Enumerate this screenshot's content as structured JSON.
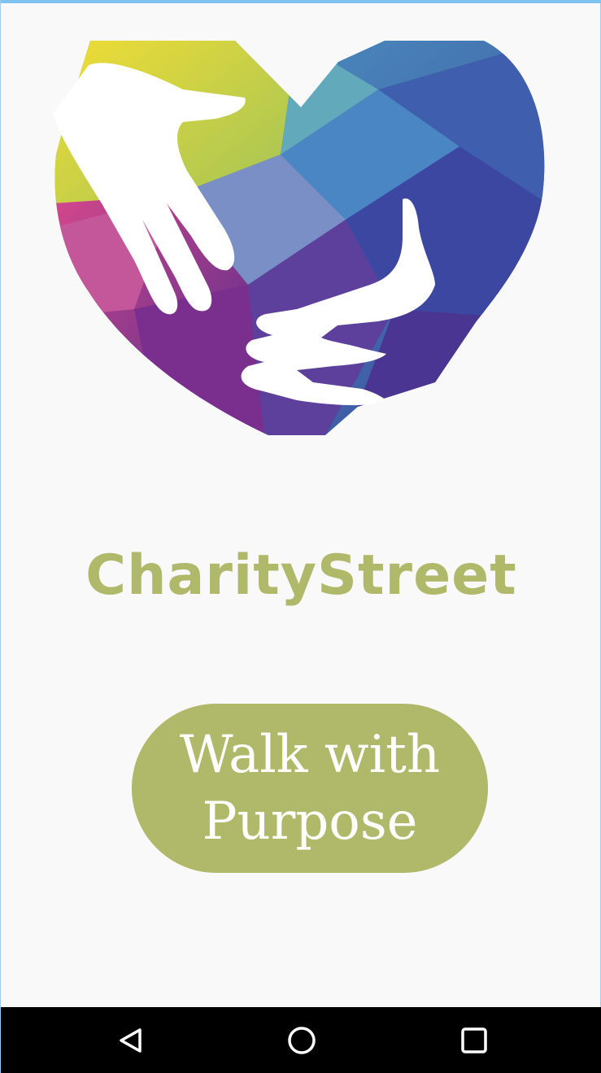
{
  "app": {
    "brand_name": "CharityStreet",
    "logo_icon": "heart-helping-hands-icon"
  },
  "cta": {
    "label": "Walk with Purpose"
  },
  "colors": {
    "accent": "#b0b869",
    "background": "#f9f9fa",
    "top_accent": "#7fc3f1",
    "nav_bar": "#000000"
  },
  "navigation_bar": {
    "icons": [
      "back-triangle-icon",
      "home-circle-icon",
      "recents-square-icon"
    ]
  }
}
